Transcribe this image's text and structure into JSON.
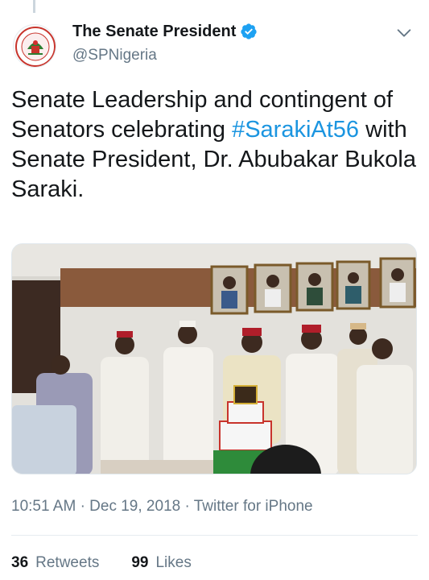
{
  "author": {
    "display_name": "The Senate President",
    "handle": "@SPNigeria"
  },
  "tweet": {
    "text_before": "Senate Leadership and contingent of Senators celebrating ",
    "hashtag": "#SarakiAt56",
    "text_after": " with Senate President, Dr. Abubakar Bukola Saraki."
  },
  "meta": {
    "time": "10:51 AM",
    "separator": "·",
    "date": "Dec 19, 2018",
    "source": "Twitter for iPhone"
  },
  "stats": {
    "retweets_count": "36",
    "retweets_label": "Retweets",
    "likes_count": "99",
    "likes_label": "Likes"
  },
  "colors": {
    "link": "#1b95e0",
    "verified": "#1da1f2",
    "secondary_text": "#657786"
  },
  "icons": [
    "verified-badge-icon",
    "chevron-down-icon"
  ]
}
